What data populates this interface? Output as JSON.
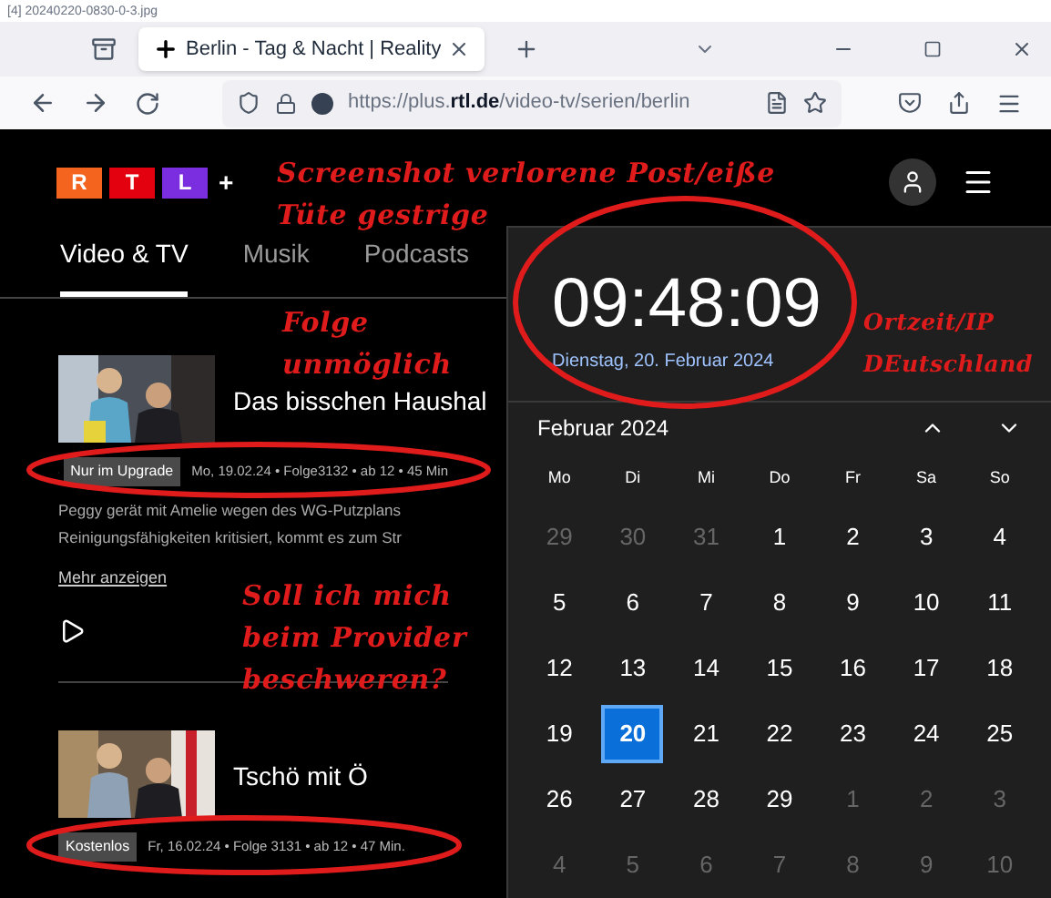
{
  "caption": "[4] 20240220-0830-0-3.jpg",
  "browser": {
    "tab_title": "Berlin - Tag & Nacht | Reality",
    "url_host": "https://plus.",
    "url_domain": "rtl.de",
    "url_path": "/video-tv/serien/berlin"
  },
  "logo": {
    "letters": [
      "R",
      "T",
      "L"
    ],
    "plus": "+"
  },
  "nav": [
    {
      "label": "Video & TV",
      "selected": true
    },
    {
      "label": "Musik",
      "selected": false
    },
    {
      "label": "Podcasts",
      "selected": false
    }
  ],
  "episodes": [
    {
      "title": "Das bisschen Haushal",
      "badge": "Nur im Upgrade",
      "locked": true,
      "meta": "Mo, 19.02.24 • Folge3132 • ab 12 • 45 Min",
      "description_lines": [
        "Peggy gerät mit Amelie wegen des WG-Putzplans",
        "Reinigungsfähigkeiten kritisiert, kommt es zum Str"
      ],
      "more": "Mehr anzeigen"
    },
    {
      "title": "Tschö mit Ö",
      "badge": "Kostenlos",
      "locked": false,
      "meta": "Fr, 16.02.24 • Folge 3131 • ab 12 • 47 Min."
    }
  ],
  "clock": {
    "time": "09:48:09",
    "date": "Dienstag, 20. Februar 2024"
  },
  "calendar": {
    "month": "Februar 2024",
    "weekdays": [
      "Mo",
      "Di",
      "Mi",
      "Do",
      "Fr",
      "Sa",
      "So"
    ],
    "weeks": [
      [
        {
          "label": "29",
          "muted": true,
          "selected": false
        },
        {
          "label": "30",
          "muted": true,
          "selected": false
        },
        {
          "label": "31",
          "muted": true,
          "selected": false
        },
        {
          "label": "1",
          "muted": false,
          "selected": false
        },
        {
          "label": "2",
          "muted": false,
          "selected": false
        },
        {
          "label": "3",
          "muted": false,
          "selected": false
        },
        {
          "label": "4",
          "muted": false,
          "selected": false
        }
      ],
      [
        {
          "label": "5",
          "muted": false,
          "selected": false
        },
        {
          "label": "6",
          "muted": false,
          "selected": false
        },
        {
          "label": "7",
          "muted": false,
          "selected": false
        },
        {
          "label": "8",
          "muted": false,
          "selected": false
        },
        {
          "label": "9",
          "muted": false,
          "selected": false
        },
        {
          "label": "10",
          "muted": false,
          "selected": false
        },
        {
          "label": "11",
          "muted": false,
          "selected": false
        }
      ],
      [
        {
          "label": "12",
          "muted": false,
          "selected": false
        },
        {
          "label": "13",
          "muted": false,
          "selected": false
        },
        {
          "label": "14",
          "muted": false,
          "selected": false
        },
        {
          "label": "15",
          "muted": false,
          "selected": false
        },
        {
          "label": "16",
          "muted": false,
          "selected": false
        },
        {
          "label": "17",
          "muted": false,
          "selected": false
        },
        {
          "label": "18",
          "muted": false,
          "selected": false
        }
      ],
      [
        {
          "label": "19",
          "muted": false,
          "selected": false
        },
        {
          "label": "20",
          "muted": false,
          "selected": true
        },
        {
          "label": "21",
          "muted": false,
          "selected": false
        },
        {
          "label": "22",
          "muted": false,
          "selected": false
        },
        {
          "label": "23",
          "muted": false,
          "selected": false
        },
        {
          "label": "24",
          "muted": false,
          "selected": false
        },
        {
          "label": "25",
          "muted": false,
          "selected": false
        }
      ],
      [
        {
          "label": "26",
          "muted": false,
          "selected": false
        },
        {
          "label": "27",
          "muted": false,
          "selected": false
        },
        {
          "label": "28",
          "muted": false,
          "selected": false
        },
        {
          "label": "29",
          "muted": false,
          "selected": false
        },
        {
          "label": "1",
          "muted": true,
          "selected": false
        },
        {
          "label": "2",
          "muted": true,
          "selected": false
        },
        {
          "label": "3",
          "muted": true,
          "selected": false
        }
      ],
      [
        {
          "label": "4",
          "muted": true,
          "selected": false
        },
        {
          "label": "5",
          "muted": true,
          "selected": false
        },
        {
          "label": "6",
          "muted": true,
          "selected": false
        },
        {
          "label": "7",
          "muted": true,
          "selected": false
        },
        {
          "label": "8",
          "muted": true,
          "selected": false
        },
        {
          "label": "9",
          "muted": true,
          "selected": false
        },
        {
          "label": "10",
          "muted": true,
          "selected": false
        }
      ]
    ]
  },
  "annotations": [
    {
      "lines": [
        "Screenshot verlorene Post/eiße",
        "Tüte gestrige"
      ]
    },
    {
      "lines": [
        "Folge",
        "unmöglich"
      ]
    },
    {
      "lines": [
        "Soll ich mich",
        "beim Provider",
        "beschweren?"
      ]
    },
    {
      "lines": [
        "Ortzeit/IP",
        "DEutschland"
      ]
    }
  ]
}
